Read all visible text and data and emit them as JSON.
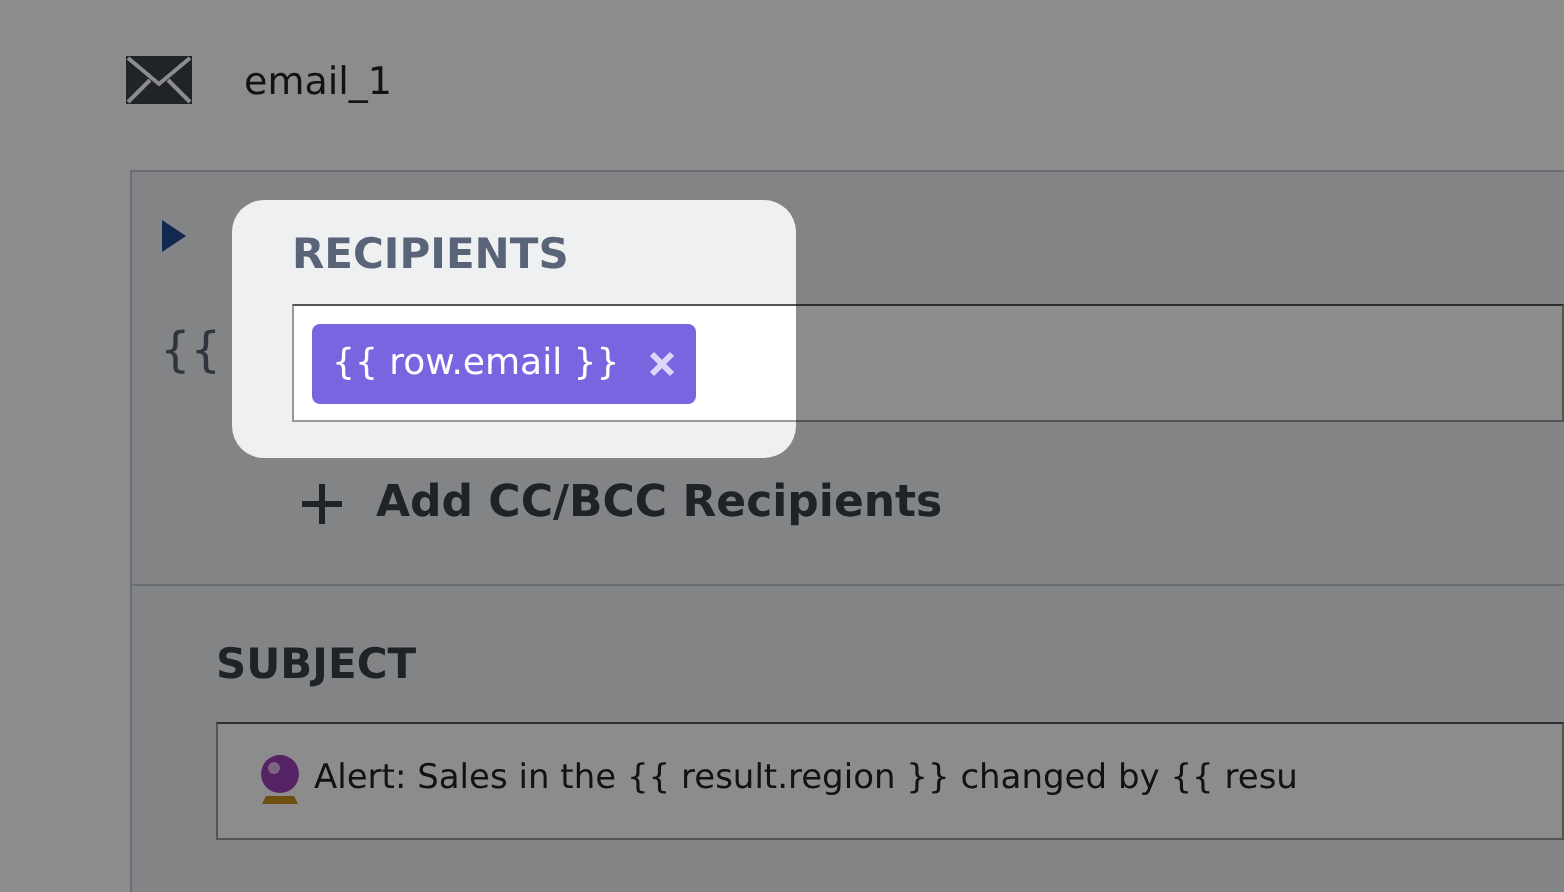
{
  "node": {
    "name": "email_1"
  },
  "recipients": {
    "label": "RECIPIENTS",
    "side_text": "{{",
    "chips": [
      {
        "text": "{{ row.email }}"
      }
    ]
  },
  "add_cc_bcc": "Add CC/BCC Recipients",
  "subject": {
    "label": "SUBJECT",
    "value": "Alert: Sales in the {{ result.region }} changed by {{ resu"
  }
}
